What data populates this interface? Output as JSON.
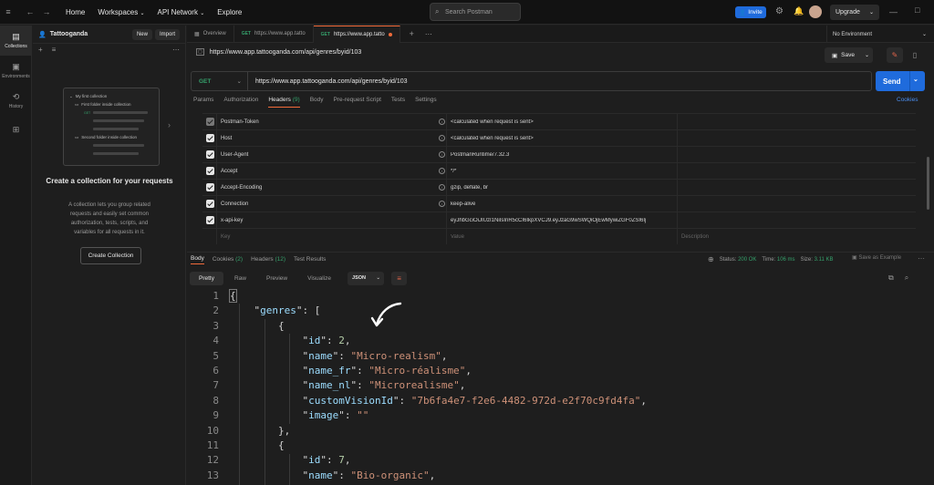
{
  "topbar": {
    "nav": [
      "Home",
      "Workspaces",
      "API Network",
      "Explore"
    ],
    "search_placeholder": "Search Postman",
    "invite": "Invite",
    "upgrade": "Upgrade"
  },
  "rail": {
    "items": [
      {
        "label": "Collections",
        "icon": "collections-icon"
      },
      {
        "label": "Environments",
        "icon": "environments-icon"
      },
      {
        "label": "History",
        "icon": "history-icon"
      },
      {
        "label": "",
        "icon": "apps-icon"
      }
    ]
  },
  "sidebar": {
    "workspace": "Tattooganda",
    "new": "New",
    "import": "Import",
    "preview": {
      "collection": "My first collection",
      "folder1": "First folder inside collection",
      "folder2": "Second folder inside collection",
      "method": "GET"
    },
    "empty_title": "Create a collection for your requests",
    "empty_body": "A collection lets you group related requests and easily set common authorization, tests, scripts, and variables for all requests in it.",
    "create_button": "Create Collection"
  },
  "tabs": [
    {
      "label": "Overview",
      "method": ""
    },
    {
      "label": "https://www.app.tatto",
      "method": "GET"
    },
    {
      "label": "https://www.app.tatto",
      "method": "GET",
      "active": true
    }
  ],
  "environment": "No Environment",
  "request": {
    "title": "https://www.app.tattooganda.com/api/genres/byid/103",
    "save": "Save",
    "method": "GET",
    "url": "https://www.app.tattooganda.com/api/genres/byid/103",
    "send": "Send",
    "subtabs": [
      {
        "label": "Params"
      },
      {
        "label": "Authorization"
      },
      {
        "label": "Headers",
        "count": "(9)",
        "active": true
      },
      {
        "label": "Body"
      },
      {
        "label": "Pre-request Script"
      },
      {
        "label": "Tests"
      },
      {
        "label": "Settings"
      }
    ],
    "cookies": "Cookies"
  },
  "headers": [
    {
      "key": "Postman-Token",
      "value": "<calculated when request is sent>",
      "dim": true
    },
    {
      "key": "Host",
      "value": "<calculated when request is sent>"
    },
    {
      "key": "User-Agent",
      "value": "PostmanRuntime/7.32.3"
    },
    {
      "key": "Accept",
      "value": "*/*"
    },
    {
      "key": "Accept-Encoding",
      "value": "gzip, deflate, br"
    },
    {
      "key": "Connection",
      "value": "keep-alive"
    },
    {
      "key": "x-api-key",
      "value": "eyJhbGciOiJIUzI1NiIsInR5cCI6IkpXVCJ9.eyJzaG9wSWQiOjEwMywiZGF0ZSI6Ij"
    }
  ],
  "header_placeholders": {
    "key": "Key",
    "value": "Value",
    "description": "Description"
  },
  "response": {
    "tabs": [
      {
        "label": "Body",
        "active": true
      },
      {
        "label": "Cookies",
        "count": "(2)"
      },
      {
        "label": "Headers",
        "count": "(12)"
      },
      {
        "label": "Test Results"
      }
    ],
    "status_label": "Status:",
    "status": "200 OK",
    "time_label": "Time:",
    "time": "106 ms",
    "size_label": "Size:",
    "size": "3.11 KB",
    "save_example": "Save as Example",
    "views": [
      "Pretty",
      "Raw",
      "Preview",
      "Visualize"
    ],
    "format": "JSON"
  },
  "code_lines": [
    {
      "n": "1",
      "html": "{"
    },
    {
      "n": "2",
      "indent": 1,
      "key": "genres",
      "after": ": ["
    },
    {
      "n": "3",
      "indent": 2,
      "plain": "{"
    },
    {
      "n": "4",
      "indent": 3,
      "key": "id",
      "num": "2"
    },
    {
      "n": "5",
      "indent": 3,
      "key": "name",
      "str": "Micro-realism"
    },
    {
      "n": "6",
      "indent": 3,
      "key": "name_fr",
      "str": "Micro-réalisme"
    },
    {
      "n": "7",
      "indent": 3,
      "key": "name_nl",
      "str": "Microrealisme"
    },
    {
      "n": "8",
      "indent": 3,
      "key": "customVisionId",
      "str": "7b6fa4e7-f2e6-4482-972d-e2f70c9fd4fa"
    },
    {
      "n": "9",
      "indent": 3,
      "key": "image",
      "str": "",
      "last": true
    },
    {
      "n": "10",
      "indent": 2,
      "plain": "},"
    },
    {
      "n": "11",
      "indent": 2,
      "plain": "{"
    },
    {
      "n": "12",
      "indent": 3,
      "key": "id",
      "num": "7"
    },
    {
      "n": "13",
      "indent": 3,
      "key": "name",
      "str": "Bio-organic"
    }
  ]
}
